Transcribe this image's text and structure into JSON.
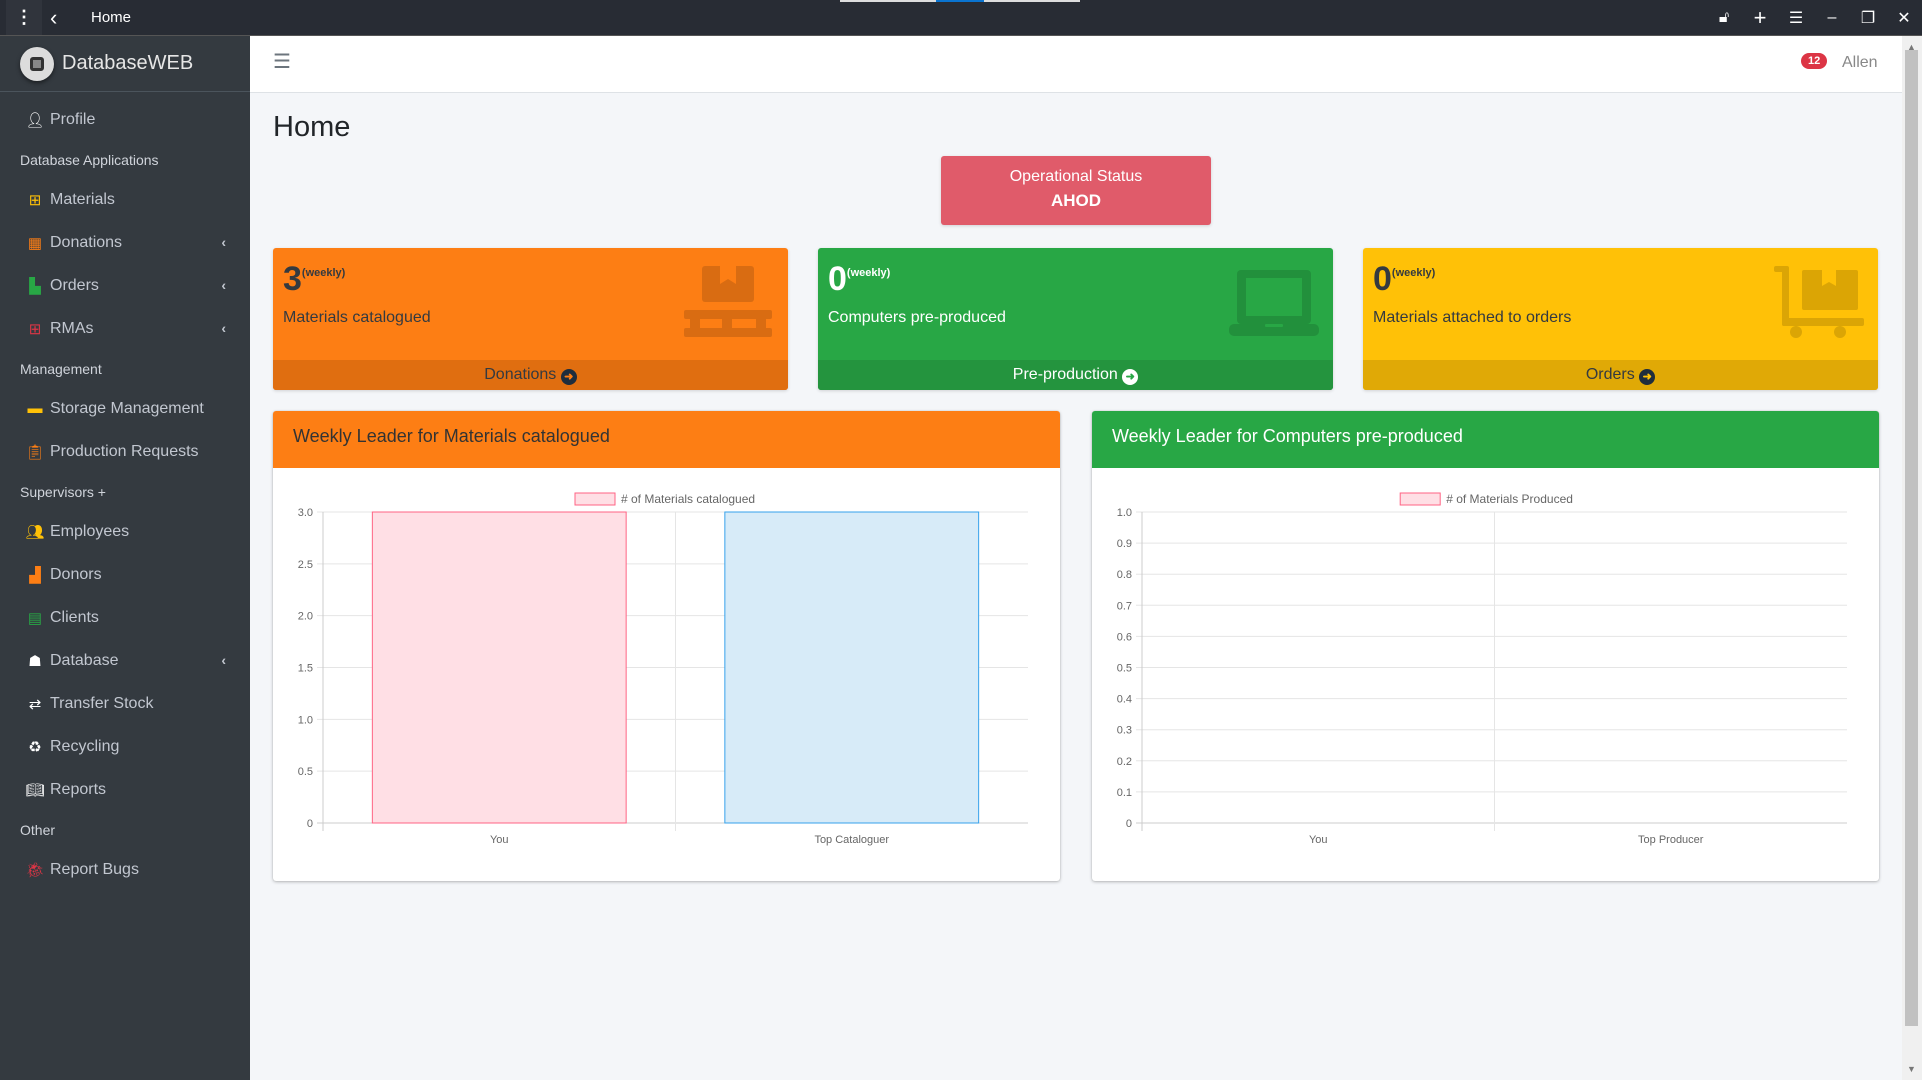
{
  "window": {
    "title": "Home",
    "controls": [
      "lock-icon",
      "plus-icon",
      "menu-icon",
      "minimize-icon",
      "restore-icon",
      "close-icon"
    ]
  },
  "brand": {
    "name_main": "Database",
    "name_suffix": "WEB"
  },
  "sidebar": {
    "profile": "Profile",
    "sections": {
      "db_apps": "Database Applications",
      "management": "Management",
      "supervisors": "Supervisors +",
      "other": "Other"
    },
    "items": {
      "materials": "Materials",
      "donations": "Donations",
      "orders": "Orders",
      "rmas": "RMAs",
      "storage": "Storage Management",
      "production": "Production Requests",
      "employees": "Employees",
      "donors": "Donors",
      "clients": "Clients",
      "database": "Database",
      "transfer": "Transfer Stock",
      "recycling": "Recycling",
      "reports": "Reports",
      "bugs": "Report Bugs"
    },
    "icon_colors": {
      "materials": "#ffc107",
      "donations": "#fd7e14",
      "orders": "#28a745",
      "rmas": "#dc3545",
      "storage": "#ffc107",
      "production": "#fd7e14",
      "employees": "#ffc107",
      "donors": "#fd7e14",
      "clients": "#28a745",
      "bugs": "#dc3545"
    }
  },
  "topnav": {
    "notifications": "12",
    "user": "Allen"
  },
  "page": {
    "title": "Home",
    "status_label": "Operational Status",
    "status_value": "AHOD"
  },
  "boxes": [
    {
      "value": "3",
      "period": "(weekly)",
      "label": "Materials catalogued",
      "link": "Donations",
      "color": "#fd7e14"
    },
    {
      "value": "0",
      "period": "(weekly)",
      "label": "Computers pre-produced",
      "link": "Pre-production",
      "color": "#28a745"
    },
    {
      "value": "0",
      "period": "(weekly)",
      "label": "Materials attached to orders",
      "link": "Orders",
      "color": "#ffc107"
    }
  ],
  "chart_data": [
    {
      "type": "bar",
      "title": "Weekly Leader for Materials catalogued",
      "legend": "# of Materials catalogued",
      "legend_position": "top",
      "categories": [
        "You",
        "Top Cataloguer"
      ],
      "values": [
        3,
        3
      ],
      "colors": [
        {
          "fill": "#ffdfe5",
          "stroke": "#ff6384"
        },
        {
          "fill": "#d7ebf8",
          "stroke": "#36a2eb"
        }
      ],
      "ylim": [
        0,
        3
      ],
      "yticks": [
        "0",
        "0.5",
        "1.0",
        "1.5",
        "2.0",
        "2.5",
        "3.0"
      ],
      "grid": true
    },
    {
      "type": "bar",
      "title": "Weekly Leader for Computers pre-produced",
      "legend": "# of Materials Produced",
      "legend_position": "top",
      "categories": [
        "You",
        "Top Producer"
      ],
      "values": [
        0,
        0
      ],
      "colors": [
        {
          "fill": "#ffdfe5",
          "stroke": "#ff6384"
        },
        {
          "fill": "#d7ebf8",
          "stroke": "#36a2eb"
        }
      ],
      "ylim": [
        0,
        1
      ],
      "yticks": [
        "0",
        "0.1",
        "0.2",
        "0.3",
        "0.4",
        "0.5",
        "0.6",
        "0.7",
        "0.8",
        "0.9",
        "1.0"
      ],
      "grid": true
    }
  ]
}
